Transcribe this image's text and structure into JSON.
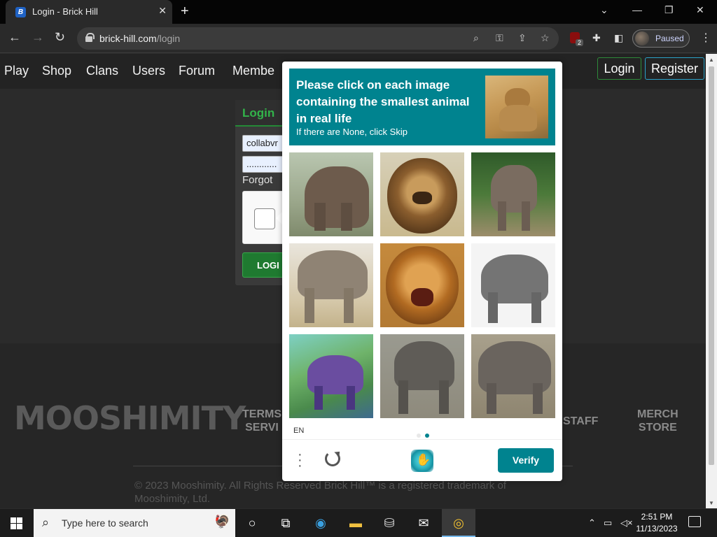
{
  "browser": {
    "tab_title": "Login - Brick Hill",
    "favicon_letter": "B",
    "url_domain": "brick-hill.com",
    "url_path": "/login",
    "profile_status": "Paused",
    "ublock_count": "2"
  },
  "site": {
    "nav": [
      "Play",
      "Shop",
      "Clans",
      "Users",
      "Forum",
      "Membe"
    ],
    "login_btn": "Login",
    "register_btn": "Register",
    "login_card": {
      "heading": "Login",
      "username_value": "collabvr",
      "password_value": "............",
      "forgot": "Forgot",
      "submit": "LOGI"
    },
    "footer": {
      "logo": "MOOSHIMITY",
      "terms_line1": "TERMS",
      "terms_line2": "SERVI",
      "staff": "STAFF",
      "merch_line1": "MERCH",
      "merch_line2": "STORE",
      "copyright": "© 2023 Mooshimity. All Rights Reserved Brick Hill™ is a registered trademark of Mooshimity, Ltd."
    }
  },
  "captcha": {
    "prompt": "Please click on each image containing the smallest animal in real life",
    "subprompt": "If there are None, click Skip",
    "language": "EN",
    "verify_label": "Verify",
    "images": [
      "elephant",
      "lion",
      "elephant",
      "elephant",
      "lion",
      "elephant",
      "elephant-painting",
      "elephant",
      "elephant"
    ],
    "accent": "#00838f"
  },
  "taskbar": {
    "search_placeholder": "Type here to search",
    "time": "2:51 PM",
    "date": "11/13/2023"
  }
}
